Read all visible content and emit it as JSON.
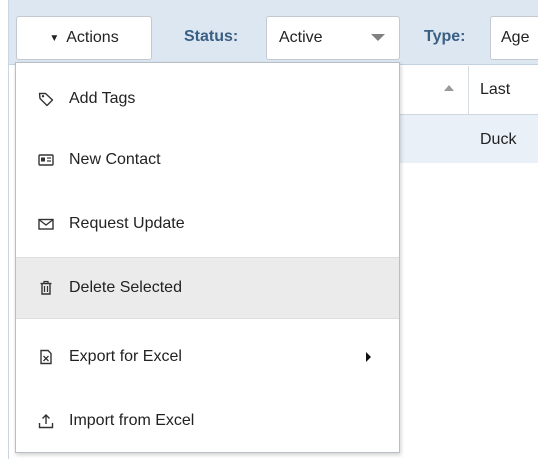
{
  "toolbar": {
    "actions_label": "Actions",
    "status_label": "Status:",
    "status_value": "Active",
    "type_label": "Type:",
    "type_value": "Age"
  },
  "grid": {
    "column_last": "Last",
    "row_last_value": "Duck"
  },
  "menu": {
    "items": [
      {
        "label": "Add Tags",
        "icon": "tag-icon"
      },
      {
        "label": "New Contact",
        "icon": "contact-card-icon"
      },
      {
        "label": "Request Update",
        "icon": "envelope-icon"
      },
      {
        "label": "Delete Selected",
        "icon": "trash-icon"
      },
      {
        "label": "Export for Excel",
        "icon": "excel-export-icon"
      },
      {
        "label": "Import from Excel",
        "icon": "upload-icon"
      }
    ]
  },
  "colors": {
    "toolbar_bg": "#dce7f1",
    "label_blue": "#3a5f84",
    "hover_bg": "#ebebeb",
    "row_bg": "#e9f0f7"
  }
}
